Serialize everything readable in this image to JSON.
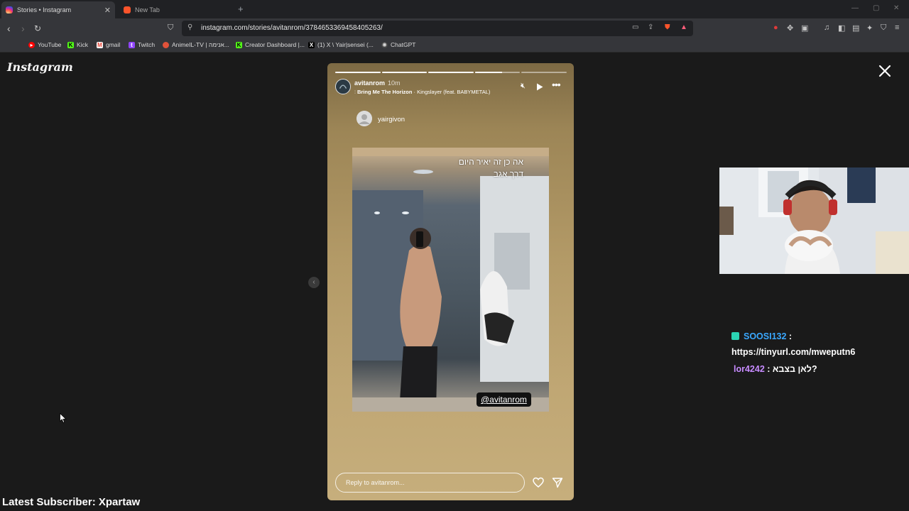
{
  "browser": {
    "tabs": [
      {
        "title": "Stories • Instagram",
        "active": true,
        "favicon": "instagram-icon"
      },
      {
        "title": "New Tab",
        "active": false,
        "favicon": "brave-icon"
      }
    ],
    "url": "instagram.com/stories/avitanrom/3784653369458405263/",
    "bookmarks": [
      {
        "label": "YouTube",
        "icon": "youtube-icon",
        "color": "#ff0000"
      },
      {
        "label": "Kick",
        "icon": "kick-icon",
        "color": "#53fc18"
      },
      {
        "label": "gmail",
        "icon": "gmail-icon",
        "color": "#ea4335"
      },
      {
        "label": "Twitch",
        "icon": "twitch-icon",
        "color": "#9146ff"
      },
      {
        "label": "AnimeIL-TV | אנימה...",
        "icon": "animeil-icon",
        "color": "#e0523a"
      },
      {
        "label": "Creator Dashboard |...",
        "icon": "kick-icon",
        "color": "#53fc18"
      },
      {
        "label": "(1) X \\ Yair|sensei (...",
        "icon": "x-icon",
        "color": "#000000"
      },
      {
        "label": "ChatGPT",
        "icon": "chatgpt-icon",
        "color": "#cccccc"
      }
    ]
  },
  "page": {
    "logo": "Instagram"
  },
  "story": {
    "username": "avitanrom",
    "time": "10m",
    "song_title": "Bring Me The Horizon",
    "song_rest": " · Kingslayer (feat. BABYMETAL)",
    "progress": [
      1,
      1,
      1,
      0.6,
      0
    ],
    "repost_user": "yairgivon",
    "caption_line1": "אה כן זה יאיר היום",
    "caption_line2": "דרך אגב",
    "mention": "@avitanrom",
    "reply_placeholder": "Reply to avitanrom..."
  },
  "chat": {
    "messages": [
      {
        "user": "SOOSI132",
        "text": "https://tinyurl.com/mweputn6"
      },
      {
        "user": "lor4242",
        "text": "לאן בצבא?"
      }
    ]
  },
  "stream": {
    "subscriber_banner": "Latest Subscriber: Xpartaw"
  }
}
